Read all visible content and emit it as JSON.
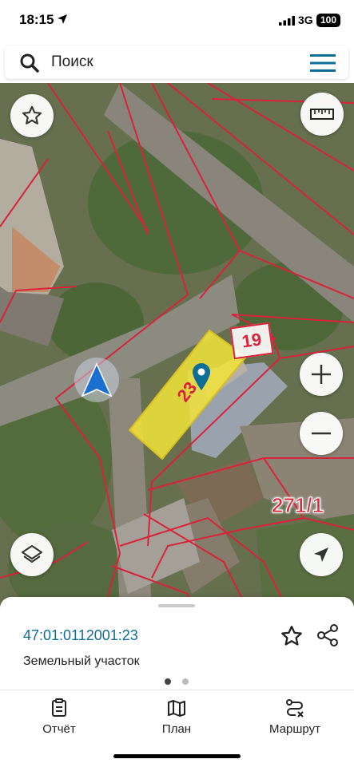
{
  "status_bar": {
    "time": "18:15",
    "network": "3G",
    "battery": "100"
  },
  "search": {
    "placeholder": "Поиск"
  },
  "map": {
    "labels": {
      "parcel_number": "23",
      "parcel_19": "19",
      "parcel_271": "271/1"
    },
    "parcel_highlight_color": "#f2e43a",
    "boundary_color": "#d8233a"
  },
  "map_controls": {
    "favorites_icon": "star-icon",
    "ruler_icon": "ruler-icon",
    "zoom_in_icon": "plus-icon",
    "zoom_out_icon": "minus-icon",
    "layers_icon": "layers-icon",
    "locate_icon": "location-arrow-icon"
  },
  "parcel_card": {
    "cadastral_number": "47:01:0112001:23",
    "type": "Земельный участок",
    "accent_color": "#0f6e96"
  },
  "tabs": [
    {
      "label": "Отчёт",
      "icon": "report-icon"
    },
    {
      "label": "План",
      "icon": "map-icon"
    },
    {
      "label": "Маршрут",
      "icon": "route-icon"
    }
  ]
}
